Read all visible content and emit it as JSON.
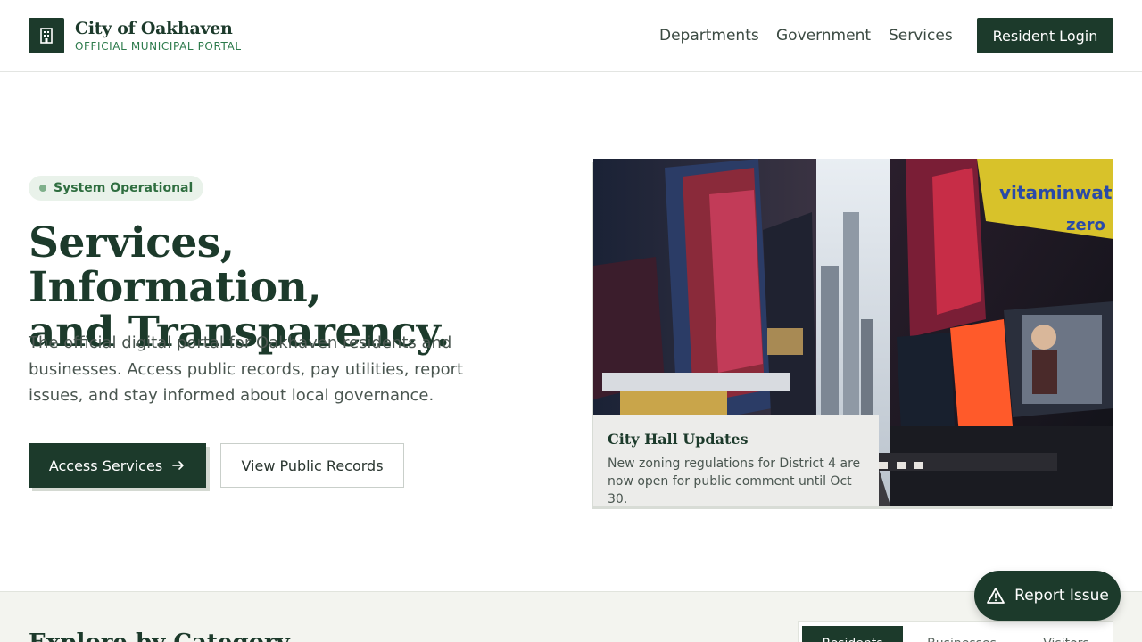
{
  "brand": {
    "name": "City of Oakhaven",
    "subtitle": "OFFICIAL MUNICIPAL PORTAL",
    "icon": "building-icon"
  },
  "nav": {
    "items": [
      "Departments",
      "Government",
      "Services"
    ],
    "login_label": "Resident Login"
  },
  "hero": {
    "status": "System Operational",
    "title_line1": "Services, Information,",
    "title_line2": "and Transparency.",
    "description": "The official digital portal for Oakhaven residents and businesses. Access public records, pay utilities, report issues, and stay informed about local governance.",
    "primary_cta": "Access Services",
    "secondary_cta": "View Public Records"
  },
  "update": {
    "title": "City Hall Updates",
    "text": "New zoning regulations for District 4 are now open for public comment until Oct 30."
  },
  "explore": {
    "title": "Explore by Category",
    "tabs": [
      "Residents",
      "Businesses",
      "Visitors"
    ]
  },
  "report": {
    "label": "Report Issue",
    "icon": "warning-triangle-icon"
  },
  "colors": {
    "primary": "#1c3a2b",
    "accent_green": "#2c7a4b",
    "status_bg": "#e9f2ea"
  }
}
